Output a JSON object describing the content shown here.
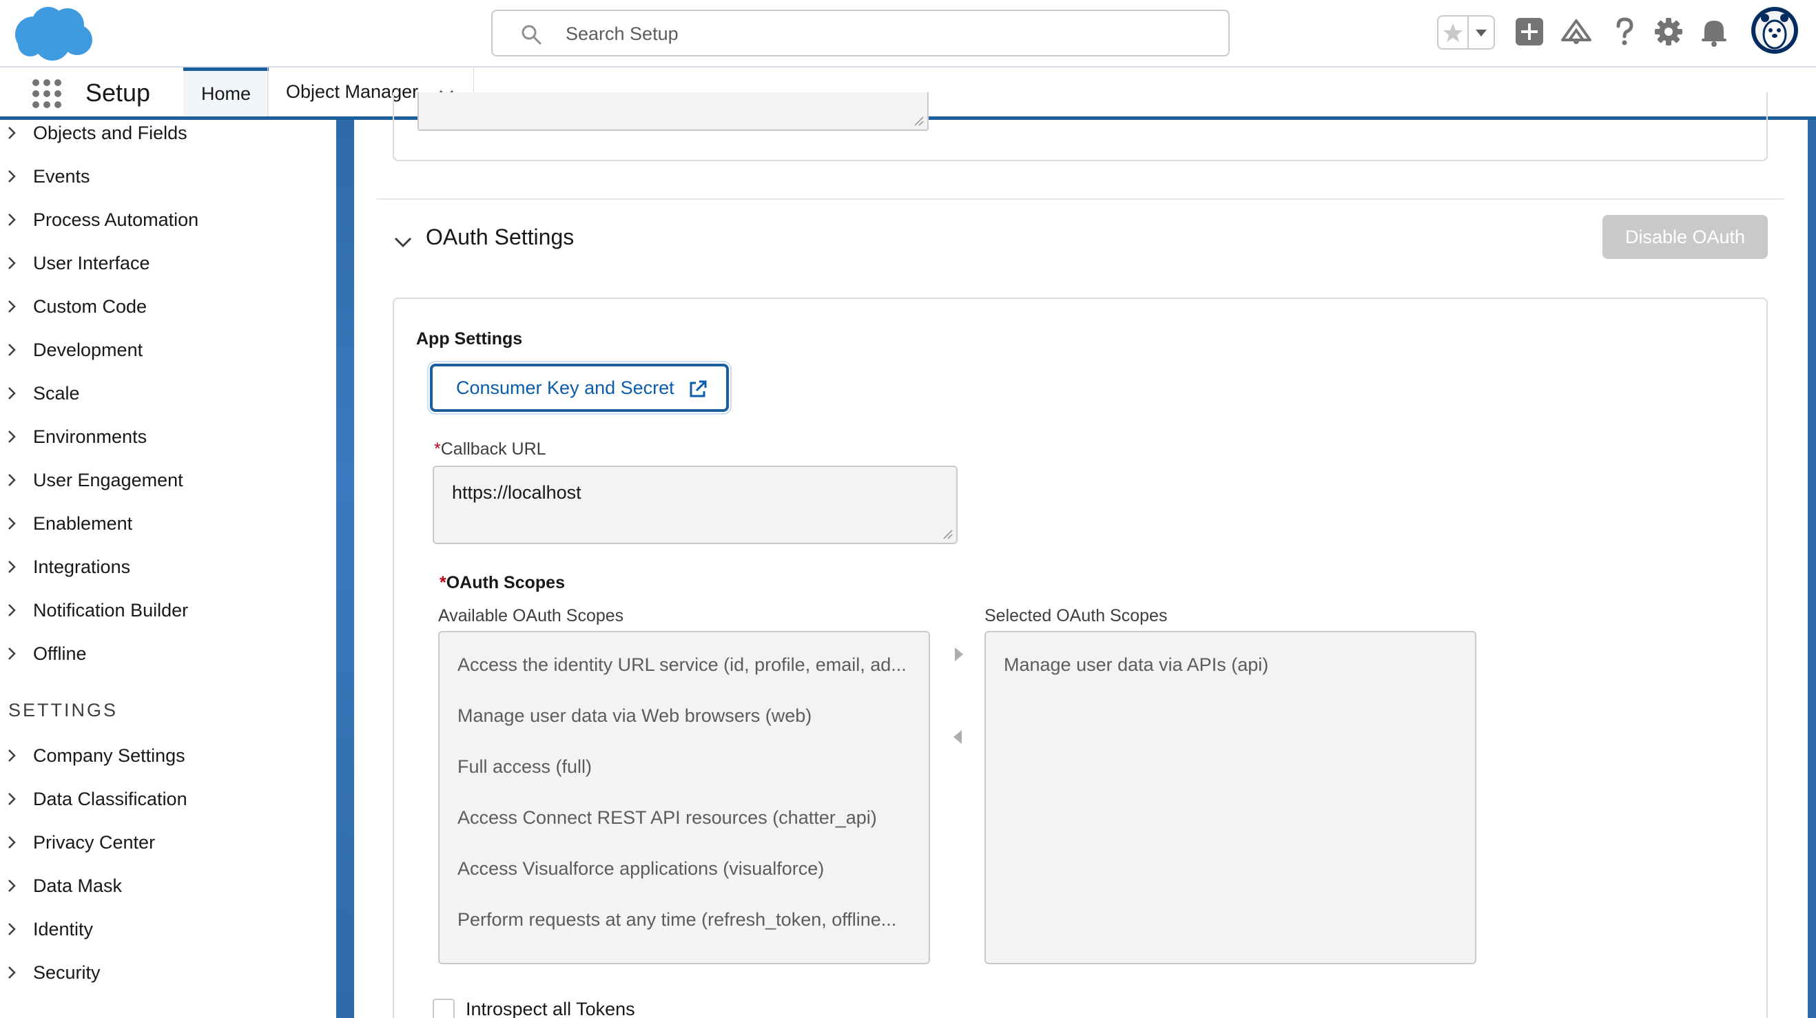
{
  "header": {
    "search_placeholder": "Search Setup",
    "icons": [
      "salesforce-cloud-logo",
      "search-icon",
      "favorites-star-icon",
      "favorites-dropdown-icon",
      "global-actions-plus-icon",
      "trailhead-icon",
      "help-icon",
      "setup-gear-icon",
      "notifications-bell-icon",
      "user-avatar"
    ]
  },
  "context_bar": {
    "app_name": "Setup",
    "tabs": [
      {
        "label": "Home",
        "active": true
      },
      {
        "label": "Object Manager",
        "active": false
      }
    ]
  },
  "sidebar": {
    "items": [
      "Objects and Fields",
      "Events",
      "Process Automation",
      "User Interface",
      "Custom Code",
      "Development",
      "Scale",
      "Environments",
      "User Engagement",
      "Enablement",
      "Integrations",
      "Notification Builder",
      "Offline"
    ],
    "settings_heading": "SETTINGS",
    "settings_items": [
      "Company Settings",
      "Data Classification",
      "Privacy Center",
      "Data Mask",
      "Identity",
      "Security"
    ]
  },
  "oauth": {
    "section_title": "OAuth Settings",
    "disable_button": "Disable OAuth",
    "app_settings_title": "App Settings",
    "consumer_key_button": "Consumer Key and Secret",
    "required_marker": "*",
    "callback_label": "Callback URL",
    "callback_value": "https://localhost",
    "scopes_title": "OAuth Scopes",
    "available_label": "Available OAuth Scopes",
    "selected_label": "Selected OAuth Scopes",
    "available_scopes": [
      "Access the identity URL service (id, profile, email, ad...",
      "Manage user data via Web browsers (web)",
      "Full access (full)",
      "Access Connect REST API resources (chatter_api)",
      "Access Visualforce applications (visualforce)",
      "Perform requests at any time (refresh_token, offline..."
    ],
    "selected_scopes": [
      "Manage user data via APIs (api)"
    ],
    "introspect_label": "Introspect all Tokens",
    "introspect_checked": false
  },
  "colors": {
    "brand_blue": "#1b5f9e",
    "link_blue": "#0b5cab",
    "logo_blue": "#3e9be0",
    "required_red": "#ba0517",
    "disabled_button": "#c9c9c9"
  }
}
